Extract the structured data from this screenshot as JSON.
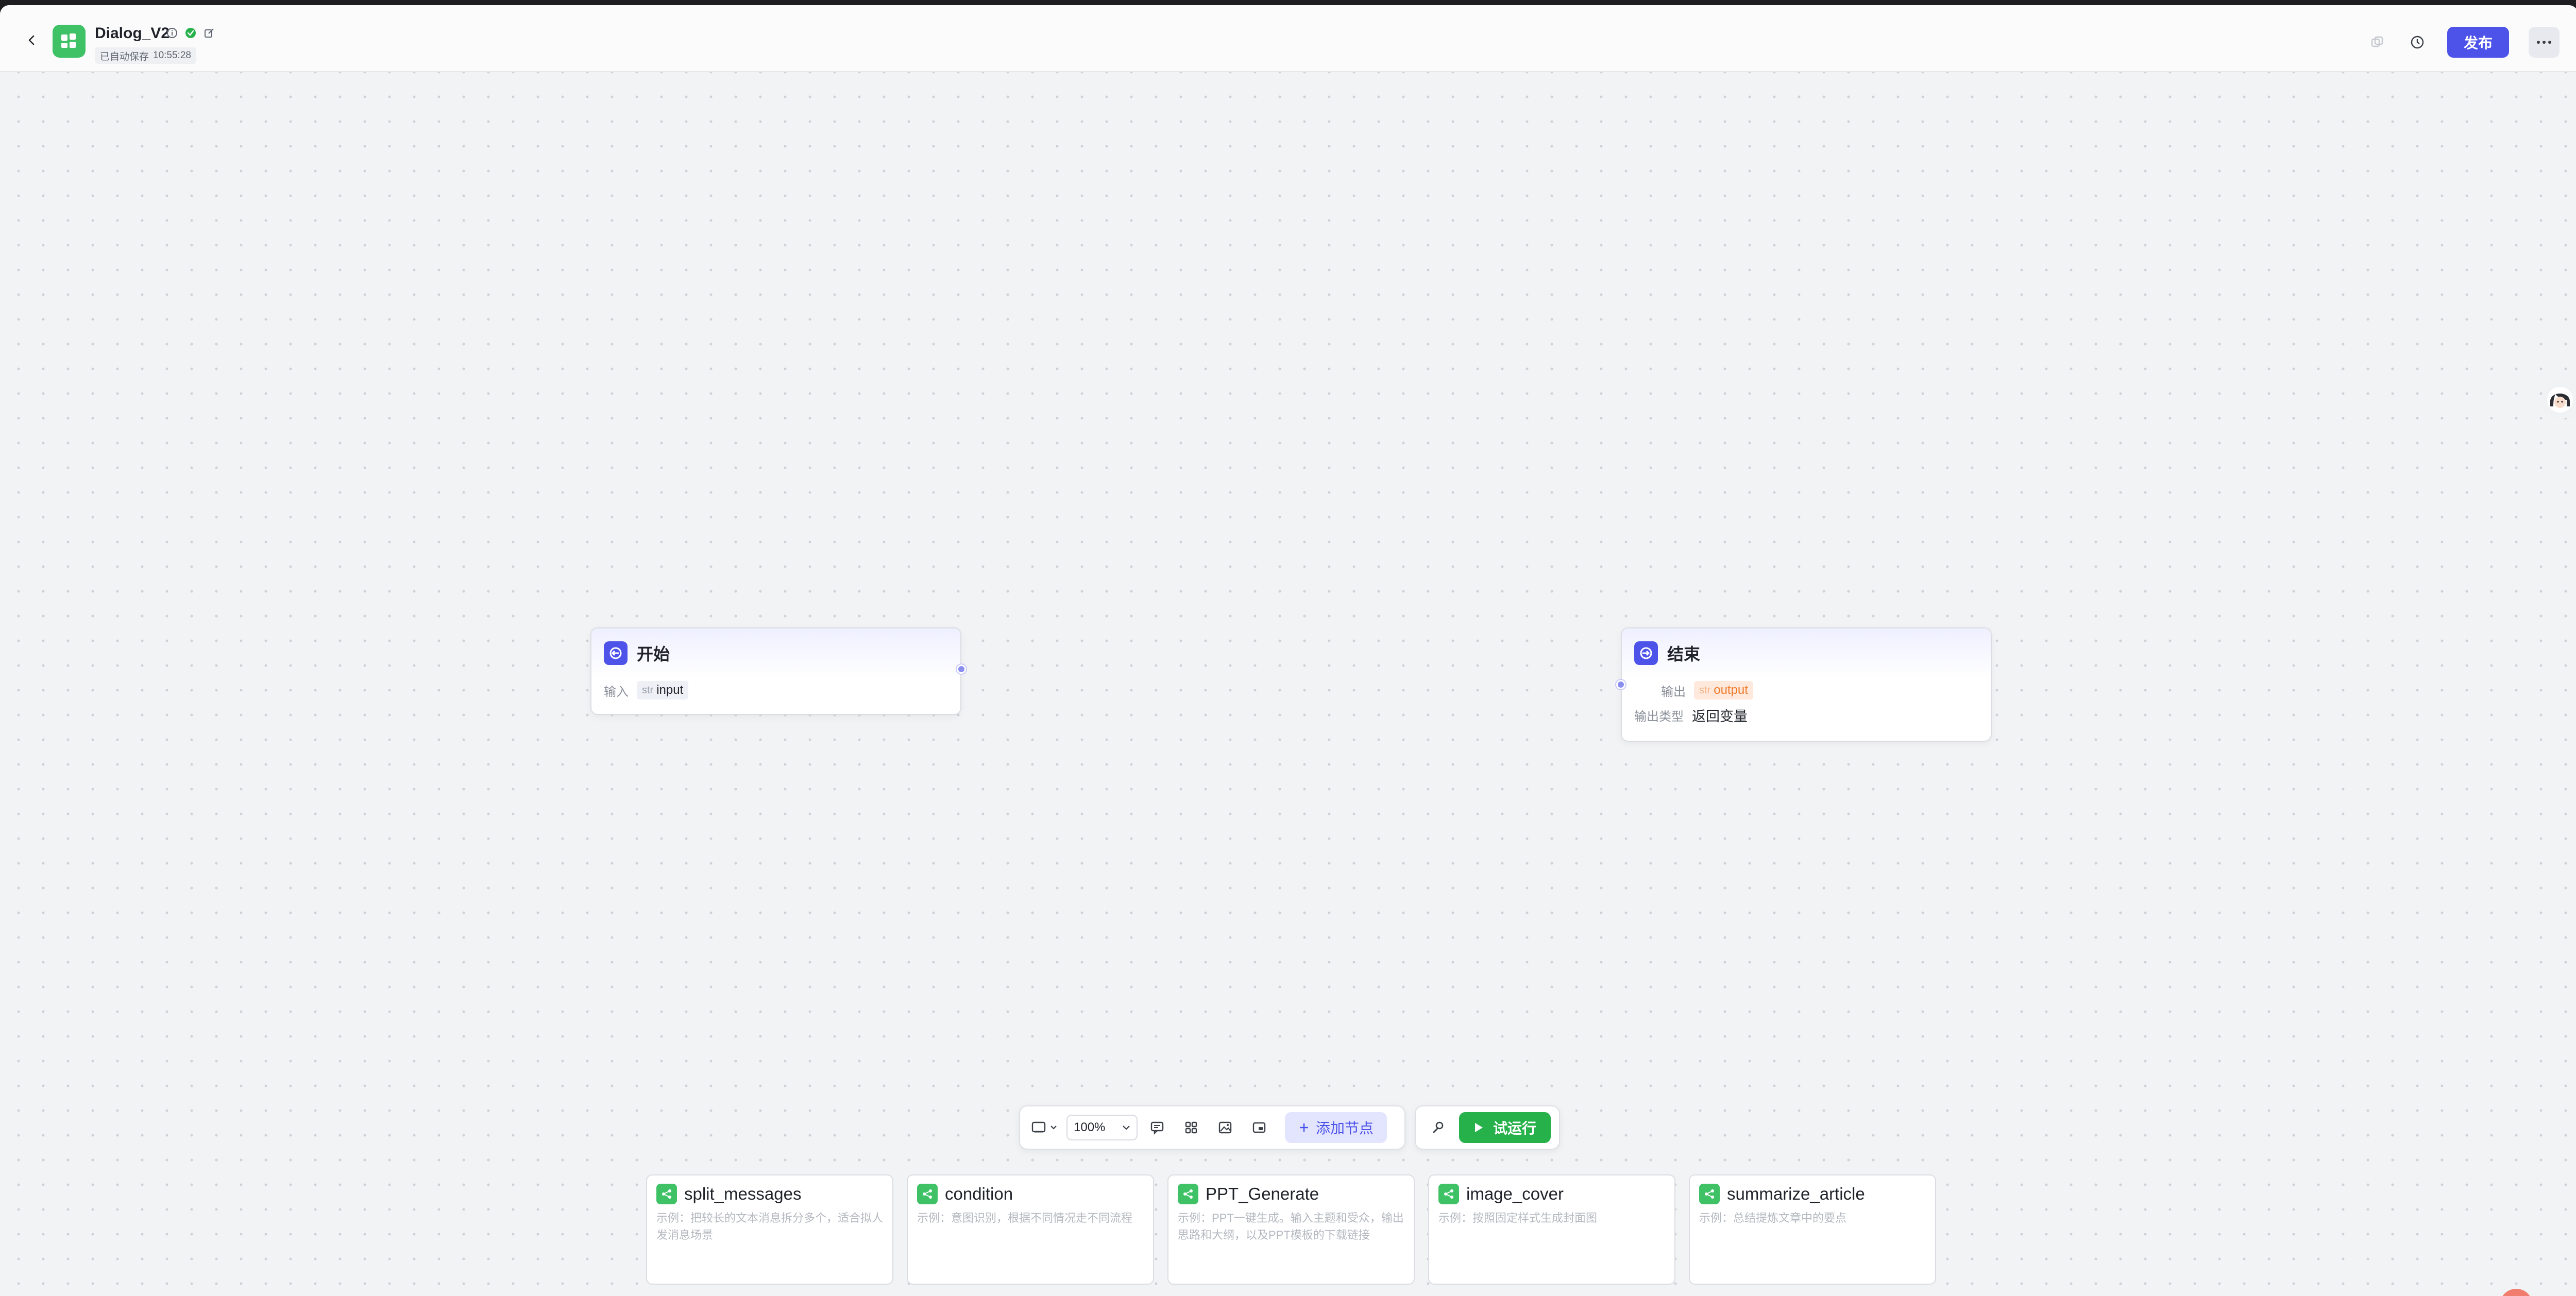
{
  "header": {
    "title": "Dialog_V2",
    "autosave_label": "已自动保存",
    "autosave_time": "10:55:28",
    "publish_label": "发布"
  },
  "nodes": {
    "start": {
      "title": "开始",
      "input_label": "输入",
      "input_type": "str",
      "input_name": "input"
    },
    "end": {
      "title": "结束",
      "output_label": "输出",
      "output_type": "str",
      "output_name": "output",
      "output_type_label": "输出类型",
      "output_type_value": "返回变量"
    }
  },
  "toolbar": {
    "zoom": "100%",
    "add_node_label": "添加节点",
    "run_label": "试运行"
  },
  "examples": [
    {
      "title": "split_messages",
      "desc": "示例：把较长的文本消息拆分多个，适合拟人发消息场景"
    },
    {
      "title": "condition",
      "desc": "示例：意图识别，根据不同情况走不同流程"
    },
    {
      "title": "PPT_Generate",
      "desc": "示例：PPT一键生成。输入主题和受众，输出思路和大纲，以及PPT模板的下载链接"
    },
    {
      "title": "image_cover",
      "desc": "示例：按照固定样式生成封面图"
    },
    {
      "title": "summarize_article",
      "desc": "示例：总结提炼文章中的要点"
    }
  ],
  "colors": {
    "accent": "#4d53e8",
    "run_green": "#27b14a",
    "workflow_green": "#3ec265",
    "output_orange": "#f07a2a"
  }
}
